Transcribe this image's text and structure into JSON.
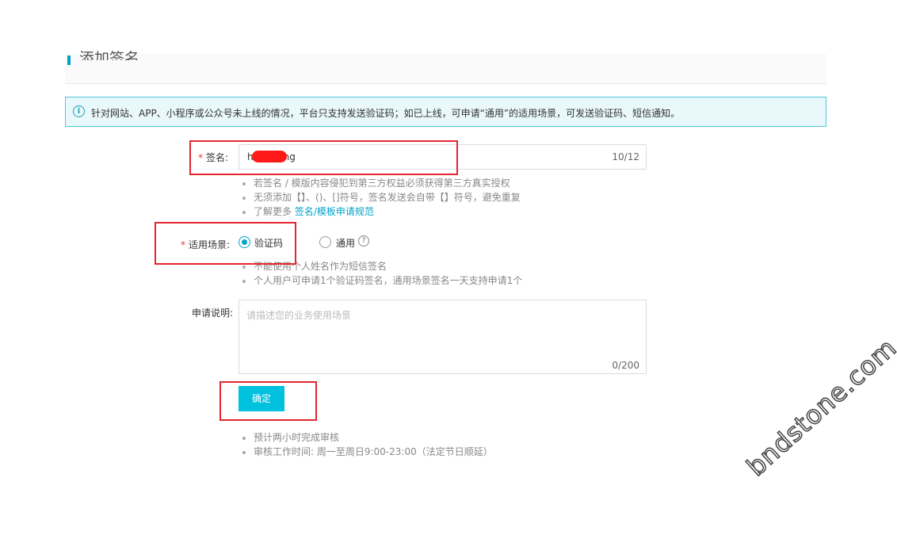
{
  "header": {
    "title": "添加签名"
  },
  "notice": {
    "icon": "info-icon",
    "text": "针对网站、APP、小程序或公众号未上线的情况，平台只支持发送验证码；如已上线，可申请“通用”的适用场景，可发送验证码、短信通知。"
  },
  "form": {
    "signature": {
      "required_mark": "*",
      "label": "签名:",
      "value_prefix": "h",
      "value_suffix": "ng",
      "counter": "10/12"
    },
    "signature_tips": [
      "若签名 / 模版内容侵犯到第三方权益必须获得第三方真实授权",
      "无须添加【】、()、[]符号，签名发送会自带【】符号，避免重复"
    ],
    "signature_more": {
      "prefix": "了解更多",
      "link": "签名/模板申请规范"
    },
    "scene": {
      "required_mark": "*",
      "label": "适用场景:",
      "options": [
        "验证码",
        "通用"
      ],
      "selected": "验证码",
      "help_icon": "question-circle-icon"
    },
    "scene_tips": [
      "不能使用个人姓名作为短信签名",
      "个人用户可申请1个验证码签名，通用场景签名一天支持申请1个"
    ],
    "description": {
      "label": "申请说明:",
      "placeholder": "请描述您的业务使用场景",
      "counter": "0/200"
    },
    "submit_label": "确定",
    "footer_tips": [
      "预计两小时完成审核",
      "审核工作时间: 周一至周日9:00-23:00（法定节日顺延）"
    ]
  },
  "watermark": "bndstone.com",
  "colors": {
    "accent": "#00c1de",
    "link": "#00a2ca",
    "highlight": "#e3262f",
    "notice_bg": "#e8f8fb"
  }
}
